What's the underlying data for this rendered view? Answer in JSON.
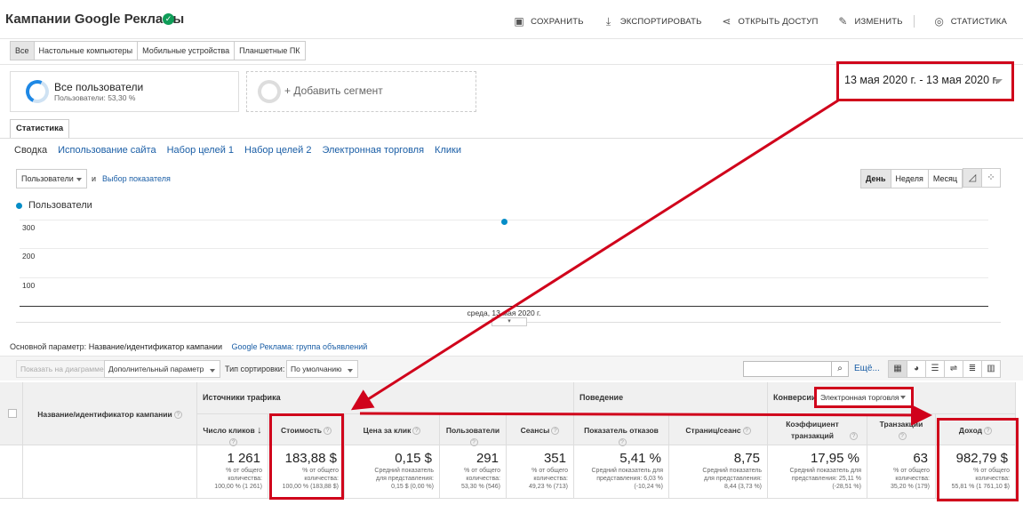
{
  "header": {
    "title": "Кампании Google Рекламы",
    "actions": [
      "СОХРАНИТЬ",
      "ЭКСПОРТИРОВАТЬ",
      "ОТКРЫТЬ ДОСТУП",
      "ИЗМЕНИТЬ",
      "СТАТИСТИКА"
    ]
  },
  "device_tabs": [
    "Все",
    "Настольные компьютеры",
    "Мобильные устройства",
    "Планшетные ПК"
  ],
  "segments": {
    "active_name": "Все пользователи",
    "active_sub": "Пользователи: 53,30 %",
    "add_label": "+ Добавить сегмент"
  },
  "date_range": "13 мая 2020 г. - 13 мая 2020 г.",
  "report_tab": "Статистика",
  "sub_tabs": [
    "Сводка",
    "Использование сайта",
    "Набор целей 1",
    "Набор целей 2",
    "Электронная торговля",
    "Клики"
  ],
  "chart_controls": {
    "metric": "Пользователи",
    "and": "и",
    "pick_metric": "Выбор показателя",
    "periods": [
      "День",
      "Неделя",
      "Месяц"
    ]
  },
  "chart_data": {
    "type": "line",
    "series": [
      {
        "name": "Пользователи",
        "values": [
          291
        ]
      }
    ],
    "x": [
      "среда, 13 мая 2020 г."
    ],
    "yticks": [
      "300",
      "200",
      "100"
    ],
    "ylim": [
      0,
      320
    ],
    "grid": true,
    "legend": "top-left"
  },
  "primary_dimension": {
    "label": "Основной параметр:",
    "value": "Название/идентификатор кампании",
    "alt": "Google Реклама: группа объявлений"
  },
  "toolbar": {
    "plot_rows": "Показать на диаграмме",
    "secondary": "Дополнительный параметр",
    "sort_label": "Тип сортировки:",
    "sort_value": "По умолчанию",
    "more": "Ещё..."
  },
  "table": {
    "dim_header": "Название/идентификатор кампании",
    "groups": {
      "acquisition": "Источники трафика",
      "behavior": "Поведение",
      "conversions": "Конверсии",
      "conversion_select": "Электронная торговля"
    },
    "columns": [
      {
        "label": "Число кликов",
        "value": "1 261",
        "note1": "% от общего",
        "note2": "количества:",
        "note3": "100,00 % (1 261)"
      },
      {
        "label": "Стоимость",
        "value": "183,88 $",
        "note1": "% от общего",
        "note2": "количества:",
        "note3": "100,00 % (183,88 $)"
      },
      {
        "label": "Цена за клик",
        "value": "0,15 $",
        "note1": "Средний показатель",
        "note2": "для представления:",
        "note3": "0,15 $ (0,00 %)"
      },
      {
        "label": "Пользователи",
        "value": "291",
        "note1": "% от общего",
        "note2": "количества:",
        "note3": "53,30 % (546)"
      },
      {
        "label": "Сеансы",
        "value": "351",
        "note1": "% от общего",
        "note2": "количества:",
        "note3": "49,23 % (713)"
      },
      {
        "label": "Показатель отказов",
        "value": "5,41 %",
        "note1": "Средний показатель для",
        "note2": "представления: 6,03 %",
        "note3": "(-10,24 %)"
      },
      {
        "label": "Страниц/сеанс",
        "value": "8,75",
        "note1": "Средний показатель",
        "note2": "для представления:",
        "note3": "8,44 (3,73 %)"
      },
      {
        "label": "Коэффициент транзакций",
        "value": "17,95 %",
        "note1": "Средний показатель для",
        "note2": "представления: 25,11 %",
        "note3": "(-28,51 %)"
      },
      {
        "label": "Транзакции",
        "value": "63",
        "note1": "% от общего",
        "note2": "количества:",
        "note3": "35,20 % (179)"
      },
      {
        "label": "Доход",
        "value": "982,79 $",
        "note1": "% от общего",
        "note2": "количества:",
        "note3": "55,81 % (1 761,10 $)"
      }
    ]
  },
  "colors": {
    "accent": "#058dc7",
    "highlight": "#d0021b",
    "link": "#1a5ea6"
  }
}
